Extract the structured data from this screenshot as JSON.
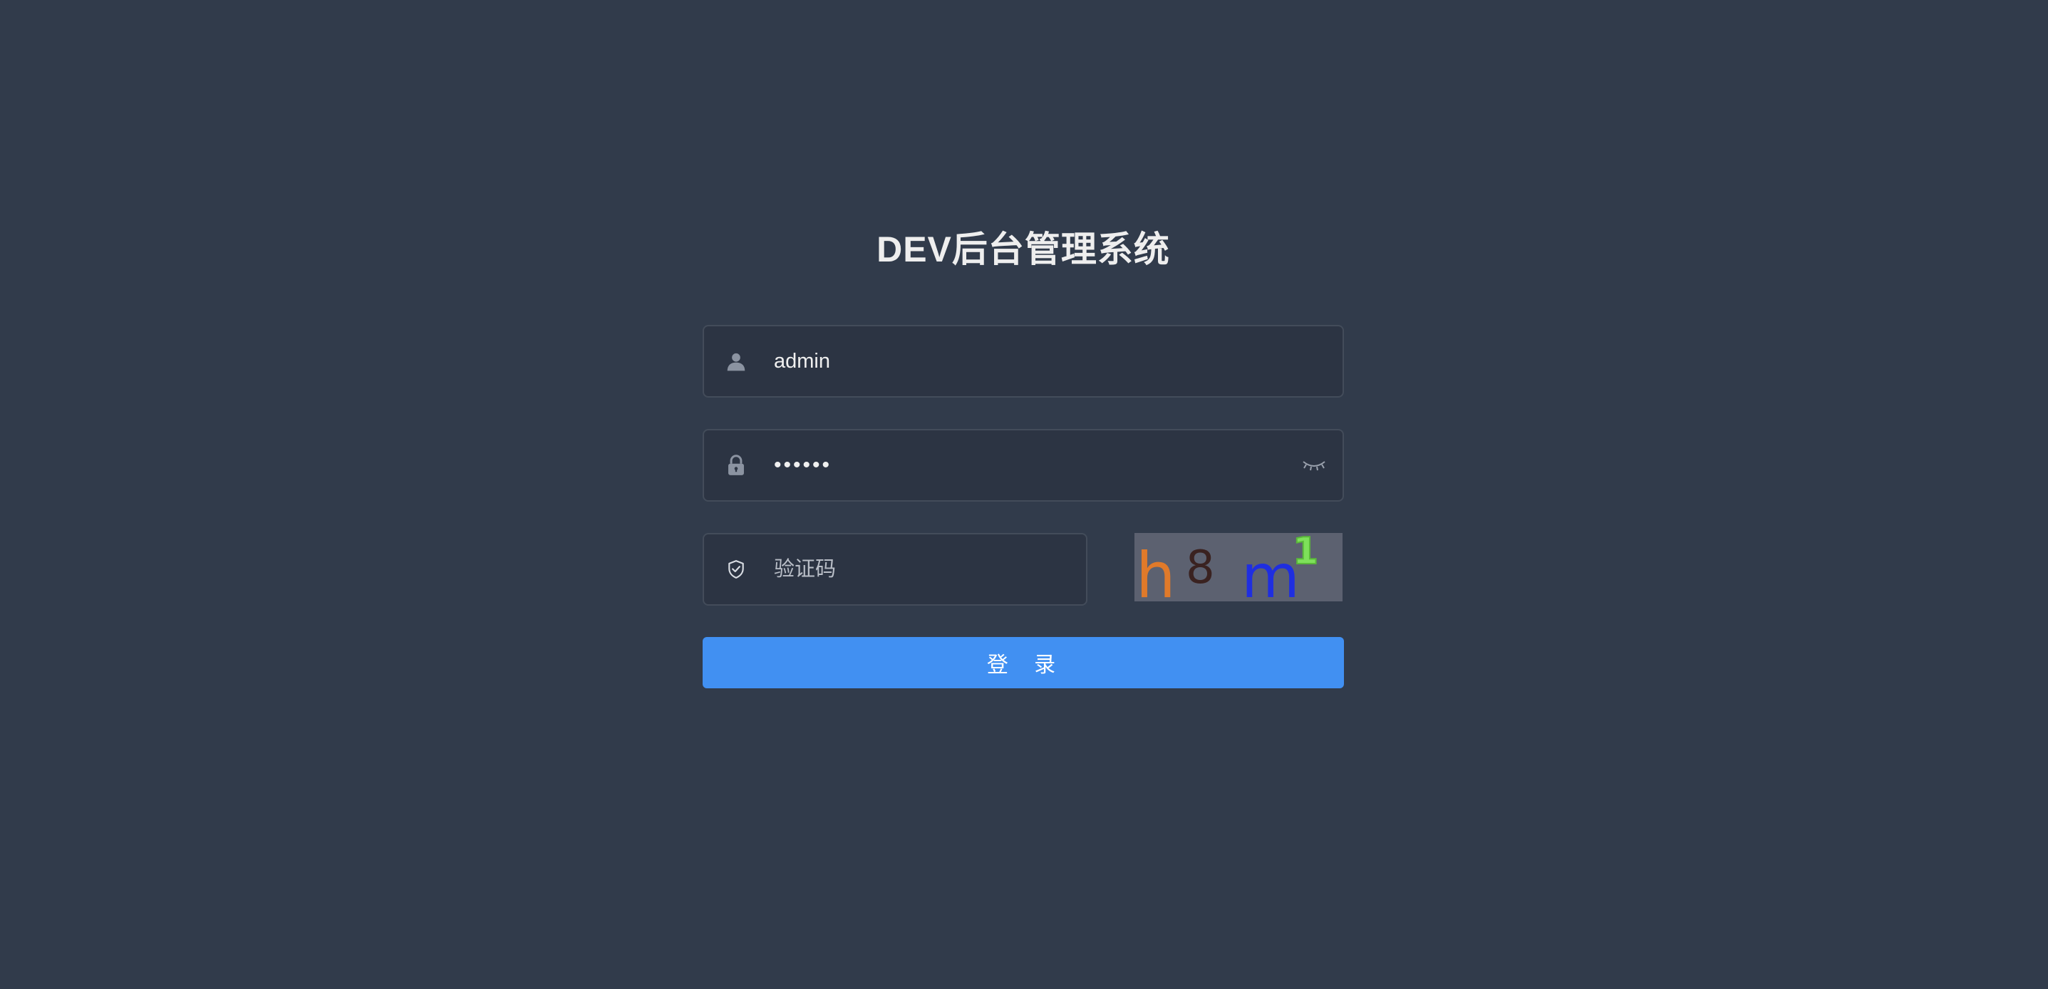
{
  "login": {
    "title": "DEV后台管理系统",
    "username": {
      "value": "admin",
      "icon": "user-icon"
    },
    "password": {
      "value": "••••••",
      "icon": "lock-icon",
      "toggle_icon": "eye-closed-icon"
    },
    "captcha": {
      "placeholder": "验证码",
      "icon": "shield-check-icon",
      "image_text": [
        "h",
        "8",
        "m",
        "1"
      ]
    },
    "submit_label": "登 录"
  },
  "colors": {
    "background": "#313b4b",
    "input_background": "#2c3443",
    "primary_button": "#4190f2",
    "captcha_background": "#5c6170"
  }
}
